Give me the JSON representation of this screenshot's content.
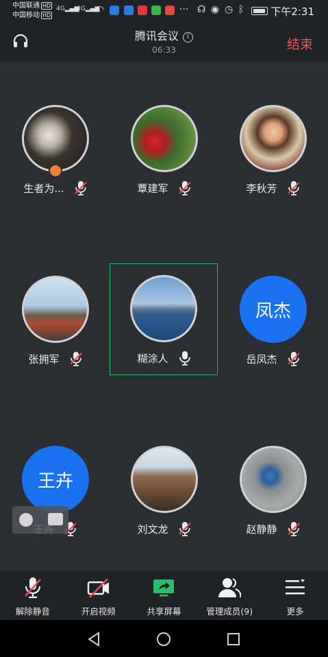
{
  "status_bar": {
    "carrier1": "中国联通",
    "carrier2": "中国移动",
    "hd_badge": "HD",
    "network": "4G",
    "time": "下午2:31"
  },
  "header": {
    "title": "腾讯会议",
    "duration": "06:33",
    "end_label": "结束"
  },
  "participants": [
    {
      "name": "生者为...",
      "mic": "muted",
      "host": true
    },
    {
      "name": "覃建军",
      "mic": "muted"
    },
    {
      "name": "李秋芳",
      "mic": "muted"
    },
    {
      "name": "张拥军",
      "mic": "muted"
    },
    {
      "name": "糊涂人",
      "mic": "on",
      "speaking": true
    },
    {
      "name": "岳凤杰",
      "mic": "muted",
      "avatar_text": "凤杰"
    },
    {
      "name": "王卉",
      "mic": "muted",
      "avatar_text": "王卉"
    },
    {
      "name": "刘文龙",
      "mic": "muted"
    },
    {
      "name": "赵静静",
      "mic": "muted"
    }
  ],
  "toolbar": {
    "unmute": "解除静音",
    "video": "开启视频",
    "share": "共享屏幕",
    "members": "管理成员(9)",
    "more": "更多"
  },
  "colors": {
    "background": "#2b2e33",
    "end_red": "#f2514e",
    "avatar_blue": "#1a72f0",
    "active_green": "#2ab46b",
    "share_green": "#27c06a",
    "muted_red": "#e84a4a"
  }
}
